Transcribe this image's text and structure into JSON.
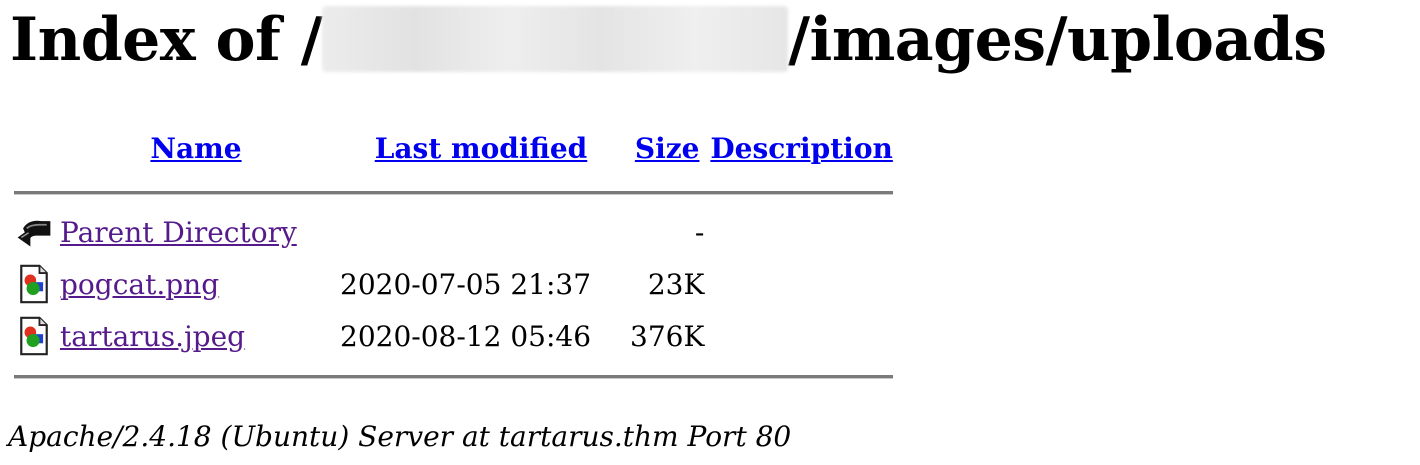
{
  "heading": {
    "prefix": "Index of /",
    "suffix": "/images/uploads"
  },
  "columns": {
    "name": "Name",
    "last_modified": "Last modified",
    "size": "Size",
    "description": "Description"
  },
  "rows": [
    {
      "icon": "back-arrow-icon",
      "name": "Parent Directory",
      "modified": "",
      "size": "-",
      "description": ""
    },
    {
      "icon": "image-file-icon",
      "name": "pogcat.png",
      "modified": "2020-07-05 21:37",
      "size": "23K",
      "description": ""
    },
    {
      "icon": "image-file-icon",
      "name": "tartarus.jpeg",
      "modified": "2020-08-12 05:46",
      "size": "376K",
      "description": ""
    }
  ],
  "footer": "Apache/2.4.18 (Ubuntu) Server at tartarus.thm Port 80",
  "colors": {
    "link": "#0000ee",
    "visited_link": "#551a8b",
    "rule": "#7a7a7a"
  }
}
